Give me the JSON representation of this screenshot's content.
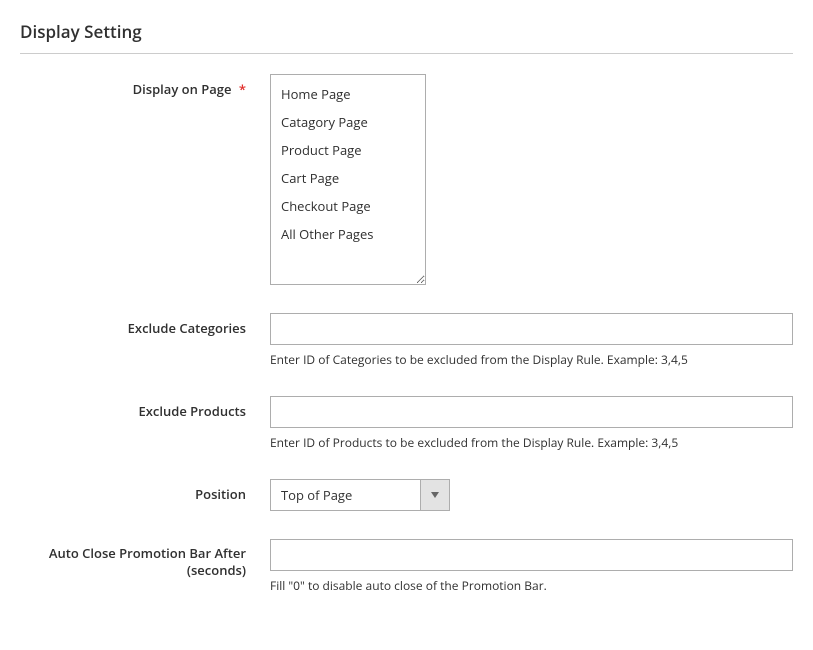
{
  "section": {
    "title": "Display Setting"
  },
  "fields": {
    "display_on_page": {
      "label": "Display on Page",
      "required": true,
      "options": [
        "Home Page",
        "Catagory Page",
        "Product Page",
        "Cart Page",
        "Checkout Page",
        "All Other Pages"
      ]
    },
    "exclude_categories": {
      "label": "Exclude Categories",
      "value": "",
      "note": "Enter ID of Categories to be excluded from the Display Rule. Example: 3,4,5"
    },
    "exclude_products": {
      "label": "Exclude Products",
      "value": "",
      "note": "Enter ID of Products to be excluded from the Display Rule. Example: 3,4,5"
    },
    "position": {
      "label": "Position",
      "value": "Top of Page"
    },
    "auto_close": {
      "label_line1": "Auto Close Promotion Bar After",
      "label_line2": "(seconds)",
      "value": "",
      "note": "Fill \"0\" to disable auto close of the Promotion Bar."
    }
  }
}
